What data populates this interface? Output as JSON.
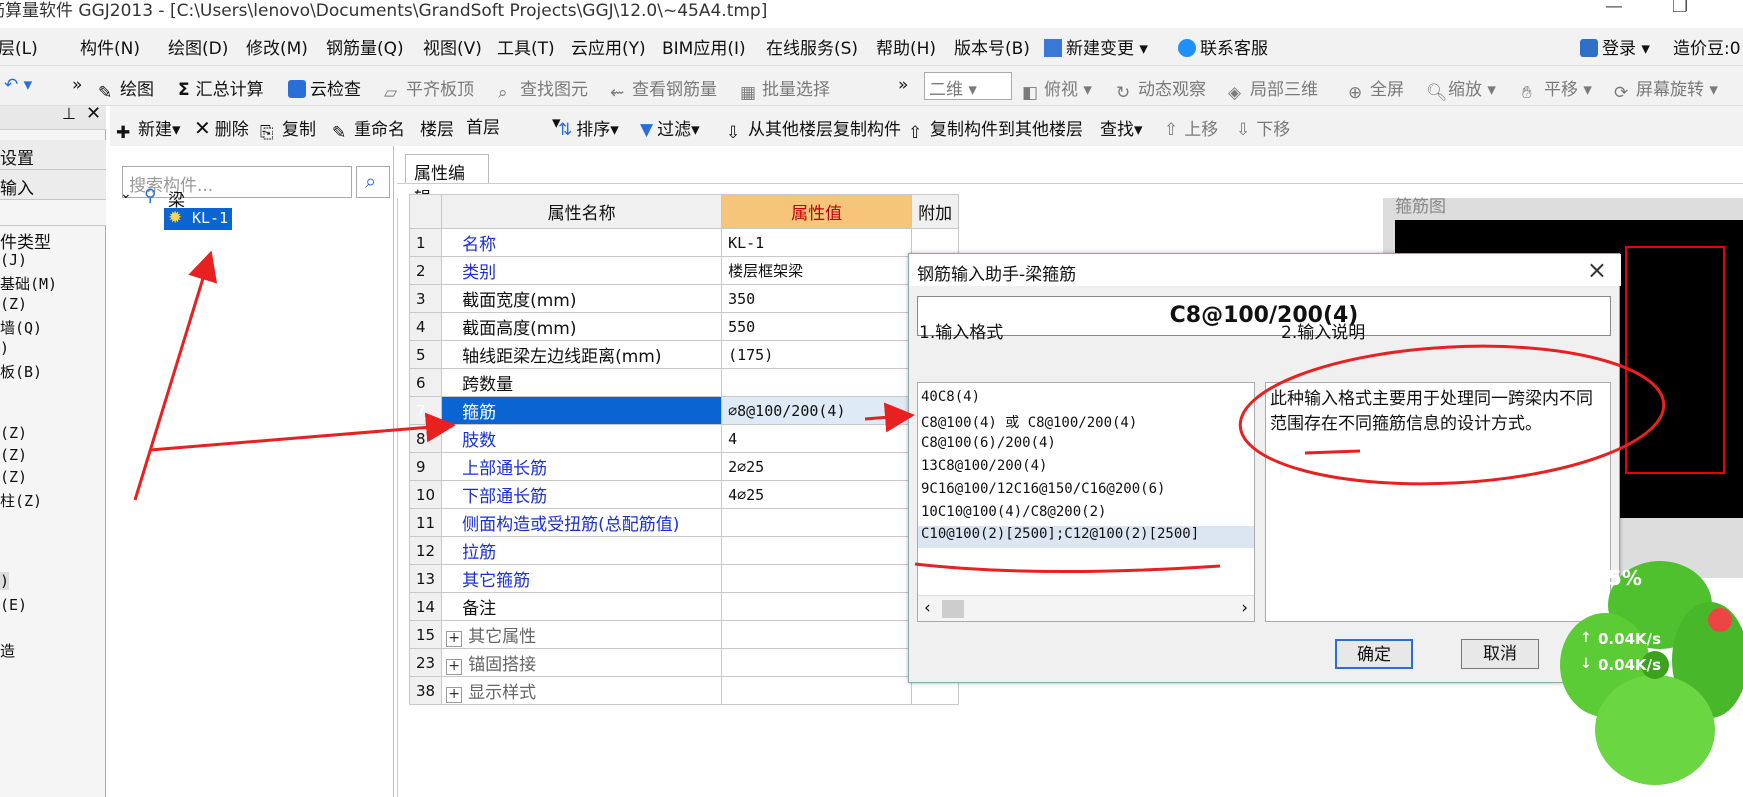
{
  "window": {
    "title": "筋算量软件 GGJ2013 - [C:\\Users\\lenovo\\Documents\\GrandSoft Projects\\GGJ\\12.0\\~45A4.tmp]"
  },
  "menu": [
    "层(L)",
    "构件(N)",
    "绘图(D)",
    "修改(M)",
    "钢筋量(Q)",
    "视图(V)",
    "工具(T)",
    "云应用(Y)",
    "BIM应用(I)",
    "在线服务(S)",
    "帮助(H)",
    "版本号(B)",
    "新建变更",
    "联系客服"
  ],
  "menu_right": {
    "login": "登录",
    "coins": "造价豆:0"
  },
  "toolbar1": {
    "draw": "绘图",
    "sum": "汇总计算",
    "cloud_check": "云检查",
    "align_top": "平齐板顶",
    "find_elem": "查找图元",
    "view_rebar": "查看钢筋量",
    "batch_select": "批量选择",
    "view_mode": "二维",
    "top_view": "俯视",
    "dynamic": "动态观察",
    "local3d": "局部三维",
    "fullscreen": "全屏",
    "zoom": "缩放",
    "pan": "平移",
    "rotate": "屏幕旋转"
  },
  "toolbar2": {
    "new": "新建",
    "delete": "删除",
    "copy": "复制",
    "rename": "重命名",
    "floor_label": "楼层",
    "floor_value": "首层",
    "sort": "排序",
    "filter": "过滤",
    "copy_from": "从其他楼层复制构件",
    "copy_to": "复制构件到其他楼层",
    "find": "查找",
    "up": "上移",
    "down": "下移"
  },
  "leftnav": {
    "sections": [
      "设置",
      "输入"
    ],
    "items": [
      "件类型",
      "(J)",
      "基础(M)",
      "(Z)",
      "墙(Q)",
      ")",
      "板(B)",
      "(Z)",
      "(Z)",
      "(Z)",
      "柱(Z)",
      ")",
      "(E)",
      "造"
    ]
  },
  "tree": {
    "search_placeholder": "搜索构件...",
    "root": "梁",
    "child": "KL-1"
  },
  "props": {
    "tab": "属性编辑",
    "headers": [
      "属性名称",
      "属性值",
      "附加"
    ],
    "rows": [
      {
        "num": "1",
        "name": "名称",
        "value": "KL-1",
        "blue": true
      },
      {
        "num": "2",
        "name": "类别",
        "value": "楼层框架梁",
        "blue": true
      },
      {
        "num": "3",
        "name": "截面宽度(mm)",
        "value": "350",
        "blue": false
      },
      {
        "num": "4",
        "name": "截面高度(mm)",
        "value": "550",
        "blue": false
      },
      {
        "num": "5",
        "name": "轴线距梁左边线距离(mm)",
        "value": "(175)",
        "blue": false
      },
      {
        "num": "6",
        "name": "跨数量",
        "value": "",
        "blue": false
      },
      {
        "num": "7",
        "name": "箍筋",
        "value": "⌀8@100/200(4)",
        "blue": true
      },
      {
        "num": "8",
        "name": "肢数",
        "value": "4",
        "blue": true
      },
      {
        "num": "9",
        "name": "上部通长筋",
        "value": "2⌀25",
        "blue": true
      },
      {
        "num": "10",
        "name": "下部通长筋",
        "value": "4⌀25",
        "blue": true
      },
      {
        "num": "11",
        "name": "侧面构造或受扭筋(总配筋值)",
        "value": "",
        "blue": true
      },
      {
        "num": "12",
        "name": "拉筋",
        "value": "",
        "blue": true
      },
      {
        "num": "13",
        "name": "其它箍筋",
        "value": "",
        "blue": true
      },
      {
        "num": "14",
        "name": "备注",
        "value": "",
        "blue": false
      },
      {
        "num": "15",
        "name": "其它属性",
        "value": "",
        "expand": true
      },
      {
        "num": "23",
        "name": "锚固搭接",
        "value": "",
        "expand": true
      },
      {
        "num": "38",
        "name": "显示样式",
        "value": "",
        "expand": true
      }
    ]
  },
  "rebar_panel": {
    "title": "箍筋图"
  },
  "dialog": {
    "title": "钢筋输入助手-梁箍筋",
    "formula": "C8@100/200(4)",
    "fmt_label": "1.输入格式",
    "desc_label": "2.输入说明",
    "formats": [
      "40C8(4)",
      "C8@100(4) 或 C8@100/200(4)",
      "C8@100(6)/200(4)",
      "13C8@100/200(4)",
      "9C16@100/12C16@150/C16@200(6)",
      "10C10@100(4)/C8@200(2)",
      "C10@100(2)[2500];C12@100(2)[2500]"
    ],
    "description": "此种输入格式主要用于处理同一跨梁内不同范围存在不同箍筋信息的设计方式。",
    "ok": "确定",
    "cancel": "取消"
  },
  "netmon": {
    "percent": "75%",
    "up": "0.04K/s",
    "down": "0.04K/s"
  }
}
